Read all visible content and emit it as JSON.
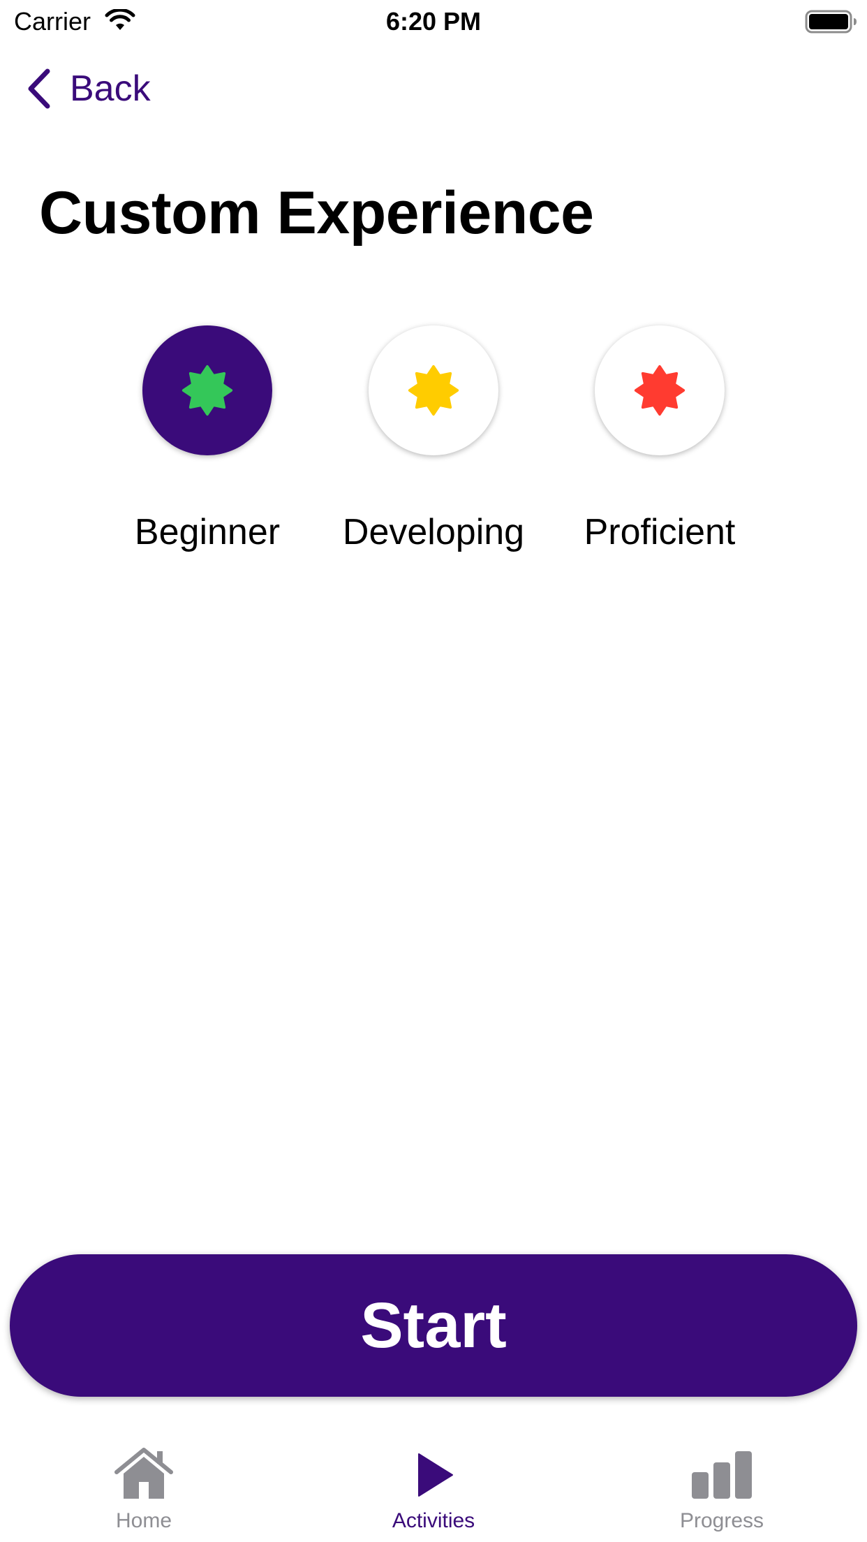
{
  "status_bar": {
    "carrier": "Carrier",
    "time": "6:20 PM",
    "icons": [
      "wifi-icon",
      "battery-icon"
    ]
  },
  "nav": {
    "back_label": "Back",
    "back_icon": "chevron-left-icon"
  },
  "page": {
    "title": "Custom Experience"
  },
  "levels": [
    {
      "label": "Beginner",
      "icon": "badge-icon",
      "icon_color": "#34c759",
      "selected": true
    },
    {
      "label": "Developing",
      "icon": "badge-icon",
      "icon_color": "#ffcc00",
      "selected": false
    },
    {
      "label": "Proficient",
      "icon": "badge-icon",
      "icon_color": "#ff3b30",
      "selected": false
    }
  ],
  "actions": {
    "start_label": "Start"
  },
  "tabs": [
    {
      "label": "Home",
      "icon": "house-icon",
      "active": false
    },
    {
      "label": "Activities",
      "icon": "play-icon",
      "active": true
    },
    {
      "label": "Progress",
      "icon": "chart-bar-icon",
      "active": false
    }
  ],
  "colors": {
    "accent": "#3a0b7a",
    "inactive_tab": "#8e8e93",
    "background": "#ffffff"
  }
}
